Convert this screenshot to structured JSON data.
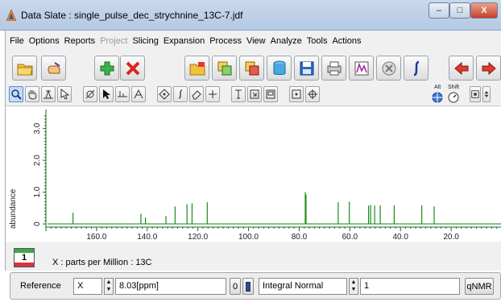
{
  "window": {
    "title": "Data Slate : single_pulse_dec_strychnine_13C-7.jdf",
    "minimize": "–",
    "maximize": "□",
    "close": "X"
  },
  "menu": {
    "items": [
      {
        "label": "File",
        "enabled": true
      },
      {
        "label": "Options",
        "enabled": true
      },
      {
        "label": "Reports",
        "enabled": true
      },
      {
        "label": "Project",
        "enabled": false
      },
      {
        "label": "Slicing",
        "enabled": true
      },
      {
        "label": "Expansion",
        "enabled": true
      },
      {
        "label": "Process",
        "enabled": true
      },
      {
        "label": "View",
        "enabled": true
      },
      {
        "label": "Analyze",
        "enabled": true
      },
      {
        "label": "Tools",
        "enabled": true
      },
      {
        "label": "Actions",
        "enabled": true
      }
    ]
  },
  "toolbar2": {
    "alt_label": "Alt",
    "shift_label": "Shift"
  },
  "chart_data": {
    "type": "line",
    "ylabel": "abundance",
    "xlabel": "X : parts per Million : 13C",
    "x_range": [
      180,
      0
    ],
    "xticks": [
      "160.0",
      "140.0",
      "120.0",
      "100.0",
      "80.0",
      "60.0",
      "40.0",
      "20.0"
    ],
    "xtick_values": [
      160,
      140,
      120,
      100,
      80,
      60,
      40,
      20
    ],
    "ylim": [
      -0.1,
      3.6
    ],
    "yticks": [
      "0",
      "1.0",
      "2.0",
      "3.0"
    ],
    "ytick_values": [
      0,
      1,
      2,
      3
    ],
    "peaks": [
      {
        "x": 169.3,
        "y": 0.35
      },
      {
        "x": 142.5,
        "y": 0.32
      },
      {
        "x": 140.7,
        "y": 0.2
      },
      {
        "x": 132.6,
        "y": 0.25
      },
      {
        "x": 129.0,
        "y": 0.55
      },
      {
        "x": 124.3,
        "y": 0.62
      },
      {
        "x": 122.3,
        "y": 0.65
      },
      {
        "x": 116.3,
        "y": 0.68
      },
      {
        "x": 77.6,
        "y": 1.0
      },
      {
        "x": 77.3,
        "y": 0.92
      },
      {
        "x": 64.6,
        "y": 0.68
      },
      {
        "x": 60.2,
        "y": 0.7
      },
      {
        "x": 52.6,
        "y": 0.58
      },
      {
        "x": 51.8,
        "y": 0.6
      },
      {
        "x": 50.2,
        "y": 0.58
      },
      {
        "x": 48.0,
        "y": 0.58
      },
      {
        "x": 42.5,
        "y": 0.58
      },
      {
        "x": 31.6,
        "y": 0.58
      },
      {
        "x": 26.7,
        "y": 0.55
      }
    ],
    "baseline": 0.0,
    "grid": false
  },
  "xinfo": {
    "badge_number": "1",
    "axis_text": "X : parts per Million : 13C"
  },
  "bottom": {
    "reference_label": "Reference",
    "axis_value": "X",
    "ppm_value": "8.03[ppm]",
    "zero_button": "0",
    "mode_value": "Integral Normal",
    "count_value": "1",
    "qnmr_button": "qNMR"
  }
}
